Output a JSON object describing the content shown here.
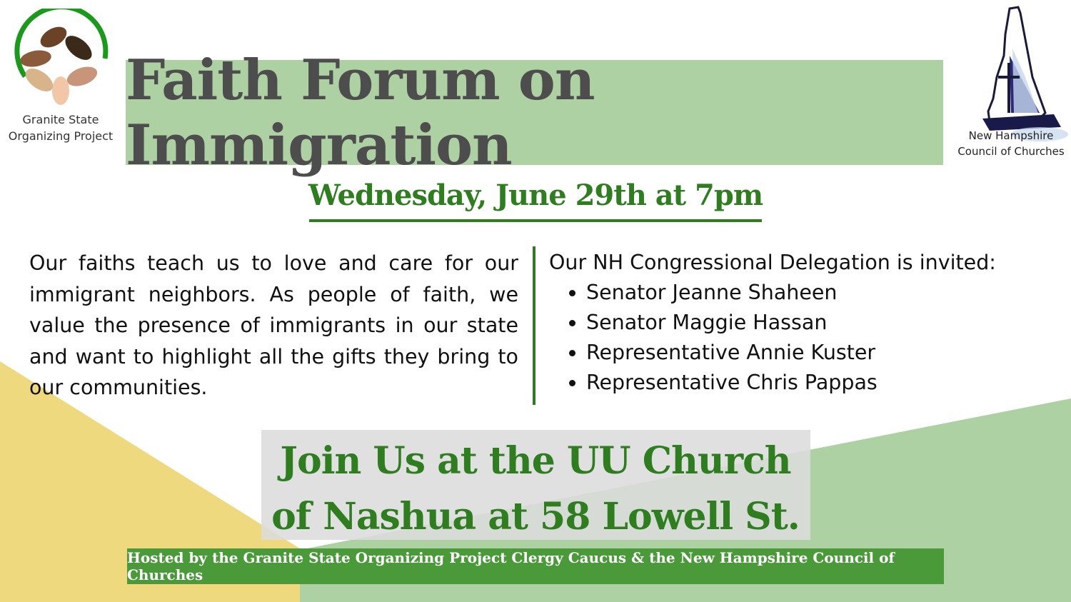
{
  "colors": {
    "title_band": "#aed1a3",
    "title_text": "#4d4d4d",
    "accent_green": "#2e7d1f",
    "hosted_band": "#4a9a3a",
    "bg_yellow": "#efd97f",
    "bg_green": "#aed1a3",
    "join_box": "#dcdcdc"
  },
  "logos": {
    "left": {
      "icon": "hands-circle-logo",
      "line1": "Granite State",
      "line2": "Organizing Project"
    },
    "right": {
      "icon": "new-hampshire-sailboat-logo",
      "line1": "New Hampshire",
      "line2": "Council of Churches"
    }
  },
  "title": "Faith Forum on Immigration",
  "date": "Wednesday, June 29th at 7pm",
  "left_paragraph": "Our faiths teach us to love and care for our immigrant neighbors. As people of faith, we value the presence of immigrants in our state and want to highlight all the gifts they bring to our communities.",
  "delegation": {
    "intro": "Our NH Congressional Delegation is invited:",
    "members": [
      "Senator Jeanne Shaheen",
      "Senator Maggie Hassan",
      "Representative Annie Kuster",
      "Representative Chris Pappas"
    ]
  },
  "join": {
    "line1": "Join Us at the UU Church",
    "line2": "of Nashua at 58 Lowell St."
  },
  "hosted_by": "Hosted by the Granite State Organizing Project Clergy Caucus & the New Hampshire Council of Churches"
}
